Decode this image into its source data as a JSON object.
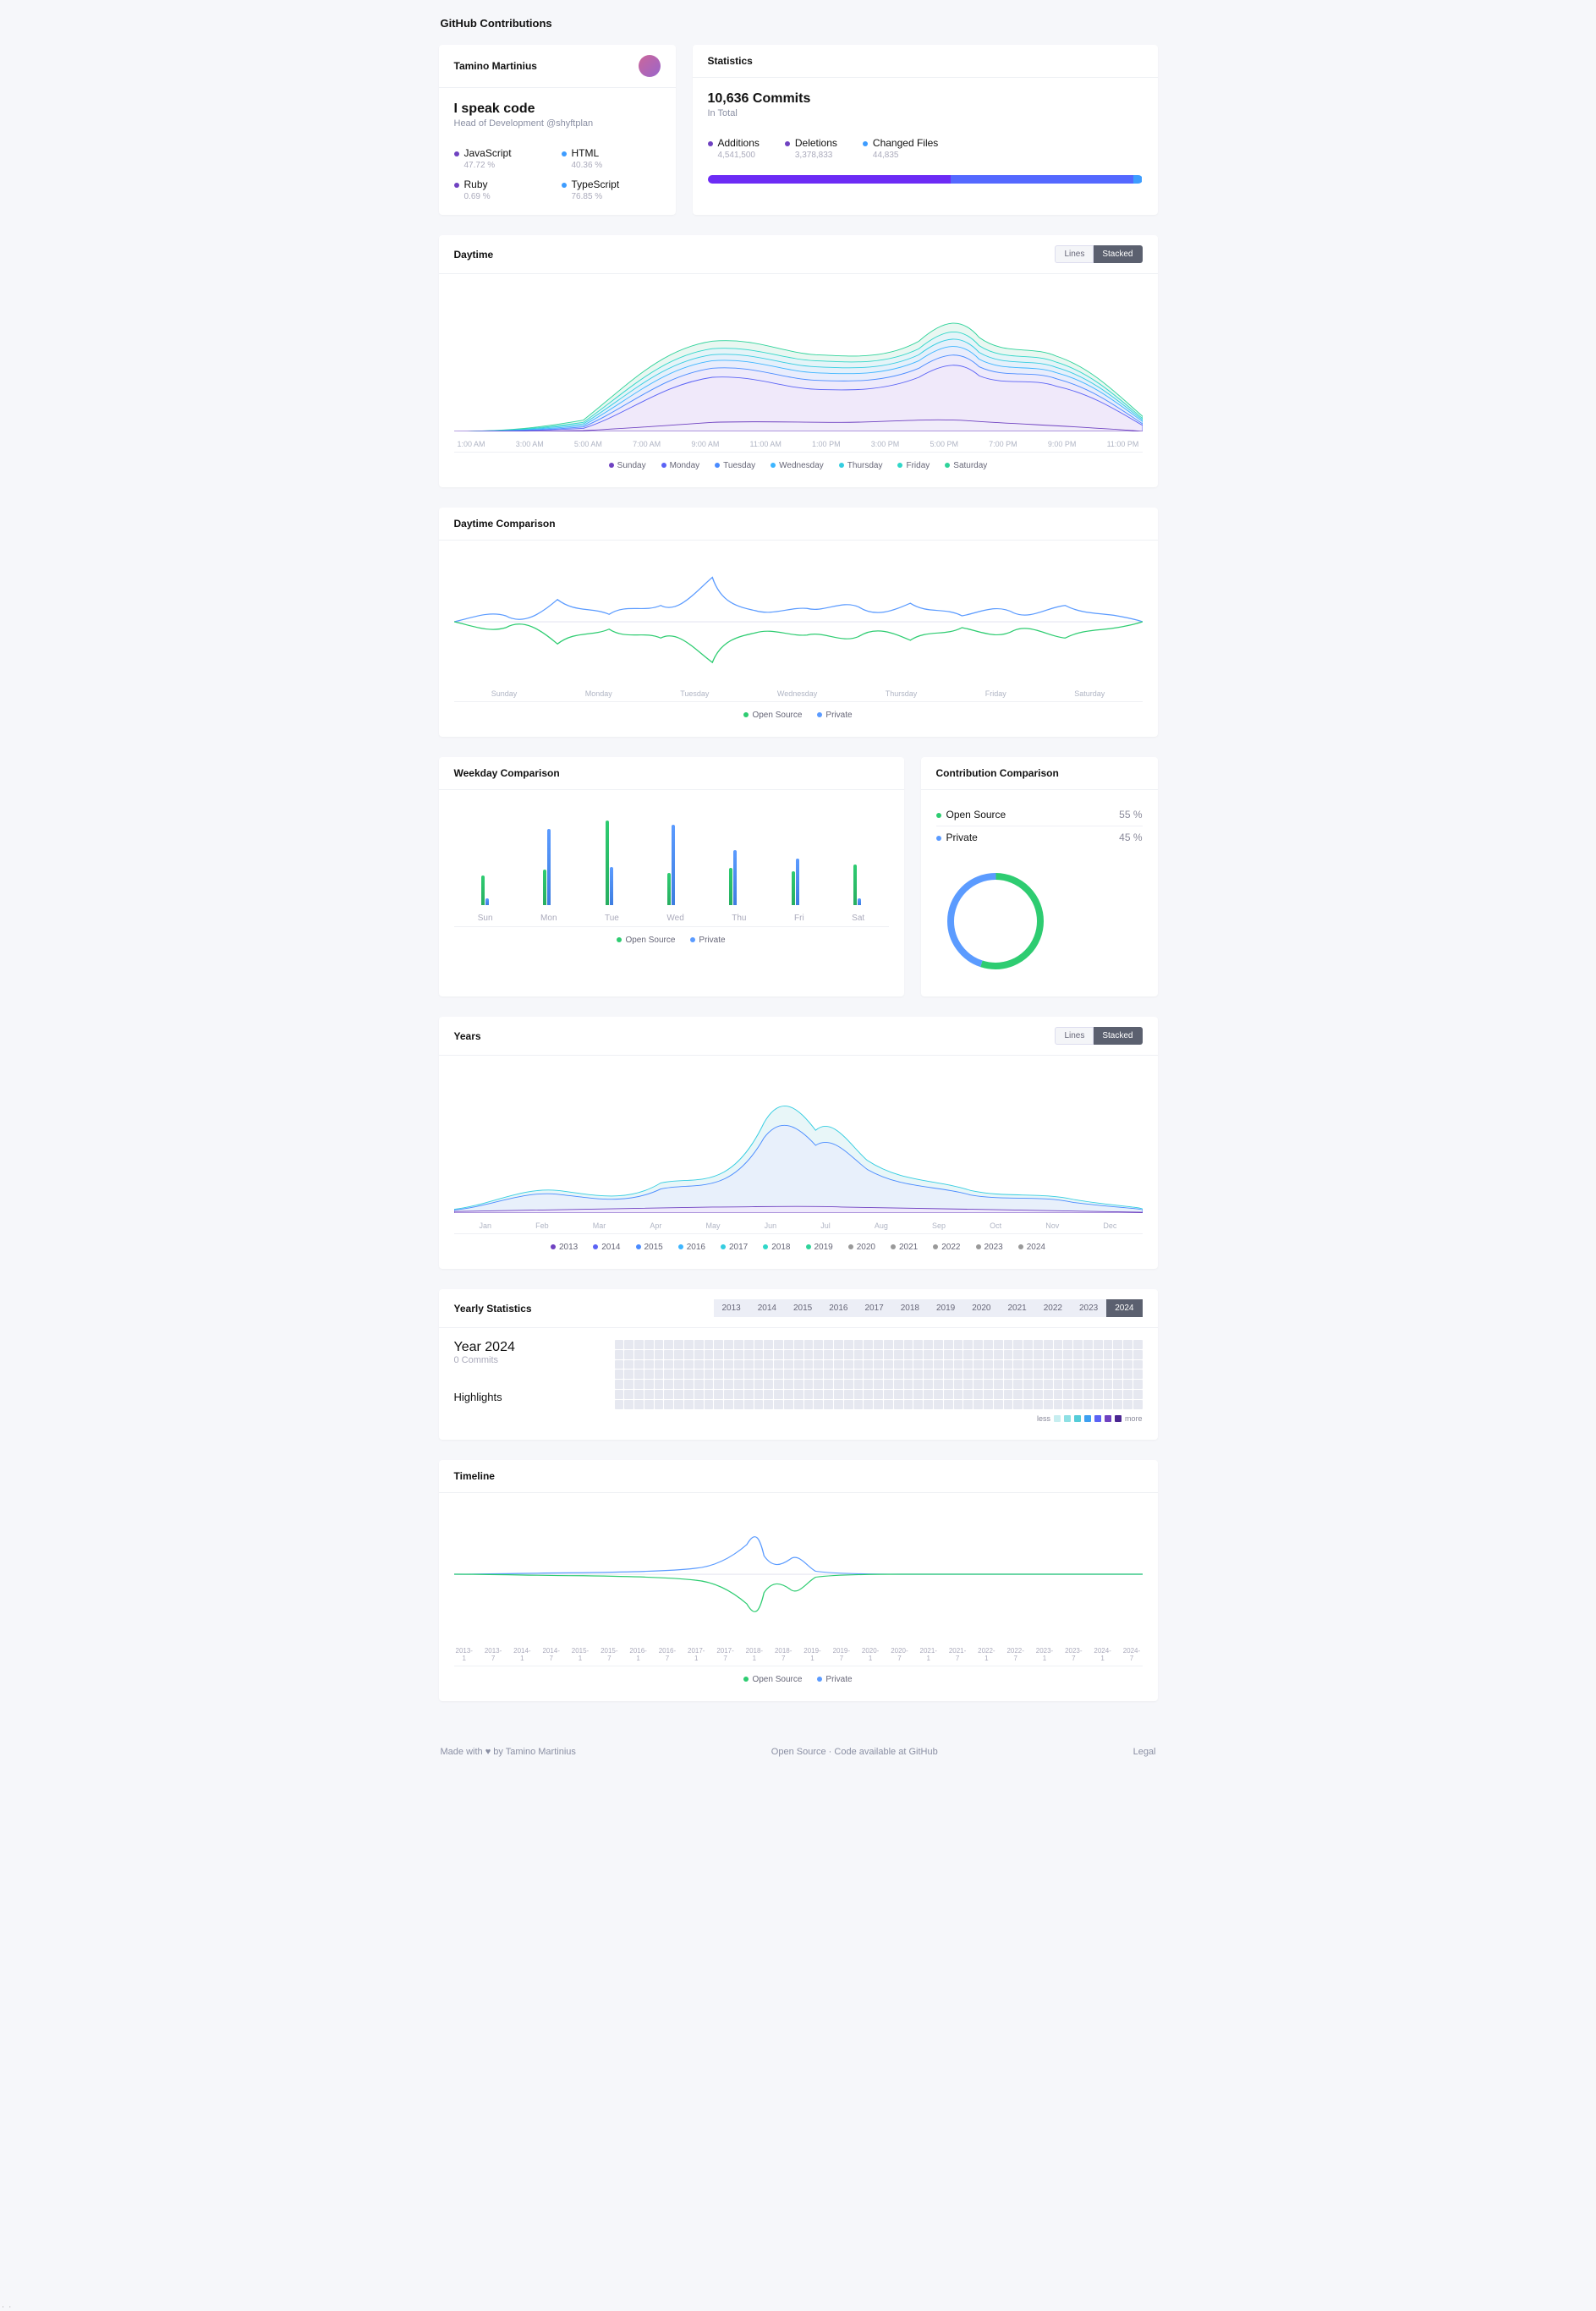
{
  "page_title": "GitHub Contributions",
  "profile": {
    "name": "Tamino Martinius",
    "headline": "I speak code",
    "role": "Head of Development ",
    "company": "@shyftplan",
    "languages": [
      {
        "name": "JavaScript",
        "pct": "47.72 %",
        "color": "#6f42c1"
      },
      {
        "name": "HTML",
        "pct": "40.36 %",
        "color": "#3d9cff"
      },
      {
        "name": "Ruby",
        "pct": "0.69 %",
        "color": "#6f42c1"
      },
      {
        "name": "TypeScript",
        "pct": "76.85 %",
        "color": "#3d9cff"
      }
    ]
  },
  "stats": {
    "header": "Statistics",
    "commits_num": "10,636 Commits",
    "commits_label": "In Total",
    "items": [
      {
        "label": "Additions",
        "value": "4,541,500",
        "color": "#6f42c1"
      },
      {
        "label": "Deletions",
        "value": "3,378,833",
        "color": "#6f42c1"
      },
      {
        "label": "Changed Files",
        "value": "44,835",
        "color": "#3d9cff"
      }
    ],
    "progress": [
      {
        "color": "#6C2BF5",
        "pct": 56
      },
      {
        "color": "#5468ff",
        "pct": 42
      },
      {
        "color": "#3d9cff",
        "pct": 2
      }
    ]
  },
  "daytime": {
    "title": "Daytime",
    "lines_label": "Lines",
    "stacked_label": "Stacked",
    "hours": [
      "1:00 AM",
      "3:00 AM",
      "5:00 AM",
      "7:00 AM",
      "9:00 AM",
      "11:00 AM",
      "1:00 PM",
      "3:00 PM",
      "5:00 PM",
      "7:00 PM",
      "9:00 PM",
      "11:00 PM"
    ],
    "legend": [
      {
        "label": "Sunday",
        "color": "#6f42c1"
      },
      {
        "label": "Monday",
        "color": "#5b63f5"
      },
      {
        "label": "Tuesday",
        "color": "#4a8bff"
      },
      {
        "label": "Wednesday",
        "color": "#3db5ff"
      },
      {
        "label": "Thursday",
        "color": "#35cde0"
      },
      {
        "label": "Friday",
        "color": "#30d7c8"
      },
      {
        "label": "Saturday",
        "color": "#2fd39a"
      }
    ]
  },
  "daytime_comparison": {
    "title": "Daytime Comparison",
    "days": [
      "Sunday",
      "Monday",
      "Tuesday",
      "Wednesday",
      "Thursday",
      "Friday",
      "Saturday"
    ],
    "legend": [
      {
        "label": "Open Source",
        "color": "#2ecc71"
      },
      {
        "label": "Private",
        "color": "#5b9bff"
      }
    ]
  },
  "weekday_comparison": {
    "title": "Weekday Comparison",
    "days": [
      "Sun",
      "Mon",
      "Tue",
      "Wed",
      "Thu",
      "Fri",
      "Sat"
    ],
    "legend": [
      {
        "label": "Open Source",
        "color": "#2ecc71"
      },
      {
        "label": "Private",
        "color": "#5b9bff"
      }
    ]
  },
  "contribution_comparison": {
    "title": "Contribution Comparison",
    "items": [
      {
        "label": "Open Source",
        "pct": "55 %",
        "color": "#2ecc71"
      },
      {
        "label": "Private",
        "pct": "45 %",
        "color": "#5b9bff"
      }
    ]
  },
  "years": {
    "title": "Years",
    "lines_label": "Lines",
    "stacked_label": "Stacked",
    "months": [
      "Jan",
      "Feb",
      "Mar",
      "Apr",
      "May",
      "Jun",
      "Jul",
      "Aug",
      "Sep",
      "Oct",
      "Nov",
      "Dec"
    ],
    "legend": [
      {
        "label": "2013",
        "color": "#6f42c1"
      },
      {
        "label": "2014",
        "color": "#5b63f5"
      },
      {
        "label": "2015",
        "color": "#4a8bff"
      },
      {
        "label": "2016",
        "color": "#3db5ff"
      },
      {
        "label": "2017",
        "color": "#35cde0"
      },
      {
        "label": "2018",
        "color": "#30d7c8"
      },
      {
        "label": "2019",
        "color": "#2fd39a"
      },
      {
        "label": "2020",
        "color": "#999"
      },
      {
        "label": "2021",
        "color": "#999"
      },
      {
        "label": "2022",
        "color": "#999"
      },
      {
        "label": "2023",
        "color": "#999"
      },
      {
        "label": "2024",
        "color": "#999"
      }
    ]
  },
  "yearly_stats": {
    "title": "Yearly Statistics",
    "tabs": [
      "2013",
      "2014",
      "2015",
      "2016",
      "2017",
      "2018",
      "2019",
      "2020",
      "2021",
      "2022",
      "2023",
      "2024"
    ],
    "active_tab": "2024",
    "year_title": "Year 2024",
    "commits": "0 Commits",
    "highlights": "Highlights",
    "less": "less",
    "more": "more",
    "legend_colors": [
      "#c7eef0",
      "#8ee0e4",
      "#55ccd8",
      "#3da0f0",
      "#5b63f5",
      "#6f42c1",
      "#4a2591"
    ]
  },
  "timeline": {
    "title": "Timeline",
    "ticks": [
      {
        "y": "2013-",
        "h": "1"
      },
      {
        "y": "2013-",
        "h": "7"
      },
      {
        "y": "2014-",
        "h": "1"
      },
      {
        "y": "2014-",
        "h": "7"
      },
      {
        "y": "2015-",
        "h": "1"
      },
      {
        "y": "2015-",
        "h": "7"
      },
      {
        "y": "2016-",
        "h": "1"
      },
      {
        "y": "2016-",
        "h": "7"
      },
      {
        "y": "2017-",
        "h": "1"
      },
      {
        "y": "2017-",
        "h": "7"
      },
      {
        "y": "2018-",
        "h": "1"
      },
      {
        "y": "2018-",
        "h": "7"
      },
      {
        "y": "2019-",
        "h": "1"
      },
      {
        "y": "2019-",
        "h": "7"
      },
      {
        "y": "2020-",
        "h": "1"
      },
      {
        "y": "2020-",
        "h": "7"
      },
      {
        "y": "2021-",
        "h": "1"
      },
      {
        "y": "2021-",
        "h": "7"
      },
      {
        "y": "2022-",
        "h": "1"
      },
      {
        "y": "2022-",
        "h": "7"
      },
      {
        "y": "2023-",
        "h": "1"
      },
      {
        "y": "2023-",
        "h": "7"
      },
      {
        "y": "2024-",
        "h": "1"
      },
      {
        "y": "2024-",
        "h": "7"
      }
    ],
    "legend": [
      {
        "label": "Open Source",
        "color": "#2ecc71"
      },
      {
        "label": "Private",
        "color": "#5b9bff"
      }
    ]
  },
  "footer": {
    "made": "Made with ♥ by Tamino Martinius",
    "middle": "Open Source · Code available at GitHub",
    "legal": "Legal"
  },
  "chart_data": {
    "daytime_stacked": {
      "type": "area",
      "x_hours": [
        0,
        1,
        2,
        3,
        4,
        5,
        6,
        7,
        8,
        9,
        10,
        11,
        12,
        13,
        14,
        15,
        16,
        17,
        18,
        19,
        20,
        21,
        22,
        23
      ],
      "series_stacked_top": {
        "Sunday": [
          0,
          0,
          0,
          0,
          2,
          3,
          4,
          5,
          6,
          7,
          7,
          6,
          5,
          4,
          5,
          6,
          7,
          6,
          5,
          4,
          3,
          2,
          1,
          0
        ],
        "Monday": [
          0,
          0,
          0,
          1,
          3,
          8,
          20,
          40,
          55,
          56,
          50,
          48,
          50,
          52,
          55,
          60,
          68,
          55,
          45,
          38,
          30,
          18,
          8,
          2
        ],
        "Tuesday": [
          0,
          0,
          0,
          1,
          4,
          10,
          25,
          48,
          62,
          62,
          55,
          52,
          55,
          58,
          60,
          66,
          75,
          60,
          50,
          42,
          33,
          20,
          9,
          2
        ],
        "Wednesday": [
          0,
          0,
          0,
          1,
          4,
          12,
          28,
          52,
          66,
          66,
          58,
          55,
          58,
          60,
          63,
          70,
          80,
          63,
          52,
          44,
          35,
          22,
          10,
          3
        ],
        "Thursday": [
          0,
          0,
          0,
          1,
          5,
          14,
          30,
          56,
          70,
          70,
          62,
          58,
          60,
          63,
          66,
          73,
          84,
          66,
          55,
          46,
          36,
          23,
          11,
          3
        ],
        "Friday": [
          0,
          0,
          0,
          1,
          5,
          15,
          32,
          58,
          74,
          74,
          64,
          60,
          62,
          65,
          68,
          76,
          90,
          68,
          56,
          48,
          38,
          24,
          12,
          3
        ],
        "Saturday": [
          0,
          0,
          0,
          1,
          5,
          16,
          34,
          60,
          77,
          77,
          66,
          62,
          64,
          67,
          70,
          78,
          93,
          70,
          58,
          50,
          40,
          25,
          12,
          3
        ]
      },
      "note": "values are relative stacked-top heights estimated from the chart"
    },
    "weekday_comparison": {
      "type": "bar",
      "categories": [
        "Sun",
        "Mon",
        "Tue",
        "Wed",
        "Thu",
        "Fri",
        "Sat"
      ],
      "series": [
        {
          "name": "Open Source",
          "values": [
            35,
            42,
            100,
            38,
            44,
            40,
            48
          ]
        },
        {
          "name": "Private",
          "values": [
            8,
            90,
            45,
            95,
            65,
            55,
            8
          ]
        }
      ],
      "note": "relative heights 0-100 estimated from bars"
    },
    "contribution_comparison": {
      "type": "pie",
      "slices": [
        {
          "name": "Open Source",
          "value": 55
        },
        {
          "name": "Private",
          "value": 45
        }
      ]
    },
    "yearly_heatmap": {
      "type": "heatmap",
      "year": 2024,
      "all_zero": true
    }
  }
}
